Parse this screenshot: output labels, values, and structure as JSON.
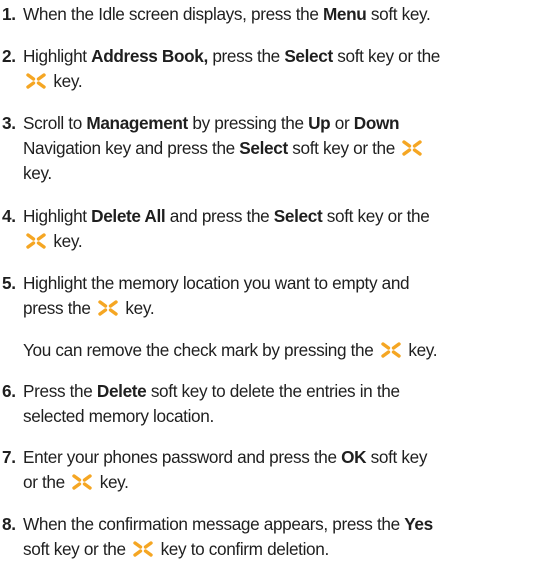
{
  "icon": {
    "name": "ok-key-icon",
    "color": "#f5a623"
  },
  "steps": [
    {
      "n": "1.",
      "parts": [
        "When the Idle screen displays, press the ",
        "Menu",
        " soft key."
      ]
    },
    {
      "n": "2.",
      "parts": [
        "Highlight ",
        "Address Book,",
        " press the ",
        "Select",
        " soft key or the",
        " key."
      ]
    },
    {
      "n": "3.",
      "parts": [
        "Scroll to ",
        "Management",
        " by pressing the ",
        "Up",
        " or ",
        "Down",
        "Navigation key and press the ",
        "Select",
        " soft key or the",
        "key."
      ]
    },
    {
      "n": "4.",
      "parts": [
        "Highlight ",
        "Delete All",
        " and press the ",
        "Select",
        " soft key or the",
        " key."
      ]
    },
    {
      "n": "5.",
      "parts": [
        "Highlight the memory location you want to empty and",
        "press the ",
        " key."
      ]
    },
    {
      "note": [
        "You can remove the check mark by pressing the ",
        " key."
      ]
    },
    {
      "n": "6.",
      "parts": [
        "Press the ",
        "Delete",
        " soft key to delete the entries in the",
        "selected memory location."
      ]
    },
    {
      "n": "7.",
      "parts": [
        "Enter your phones password and press the ",
        "OK",
        " soft key",
        "or the ",
        " key."
      ]
    },
    {
      "n": "8.",
      "parts": [
        "When the confirmation message appears, press the ",
        "Yes",
        "soft key or the ",
        " key to confirm deletion."
      ]
    }
  ]
}
